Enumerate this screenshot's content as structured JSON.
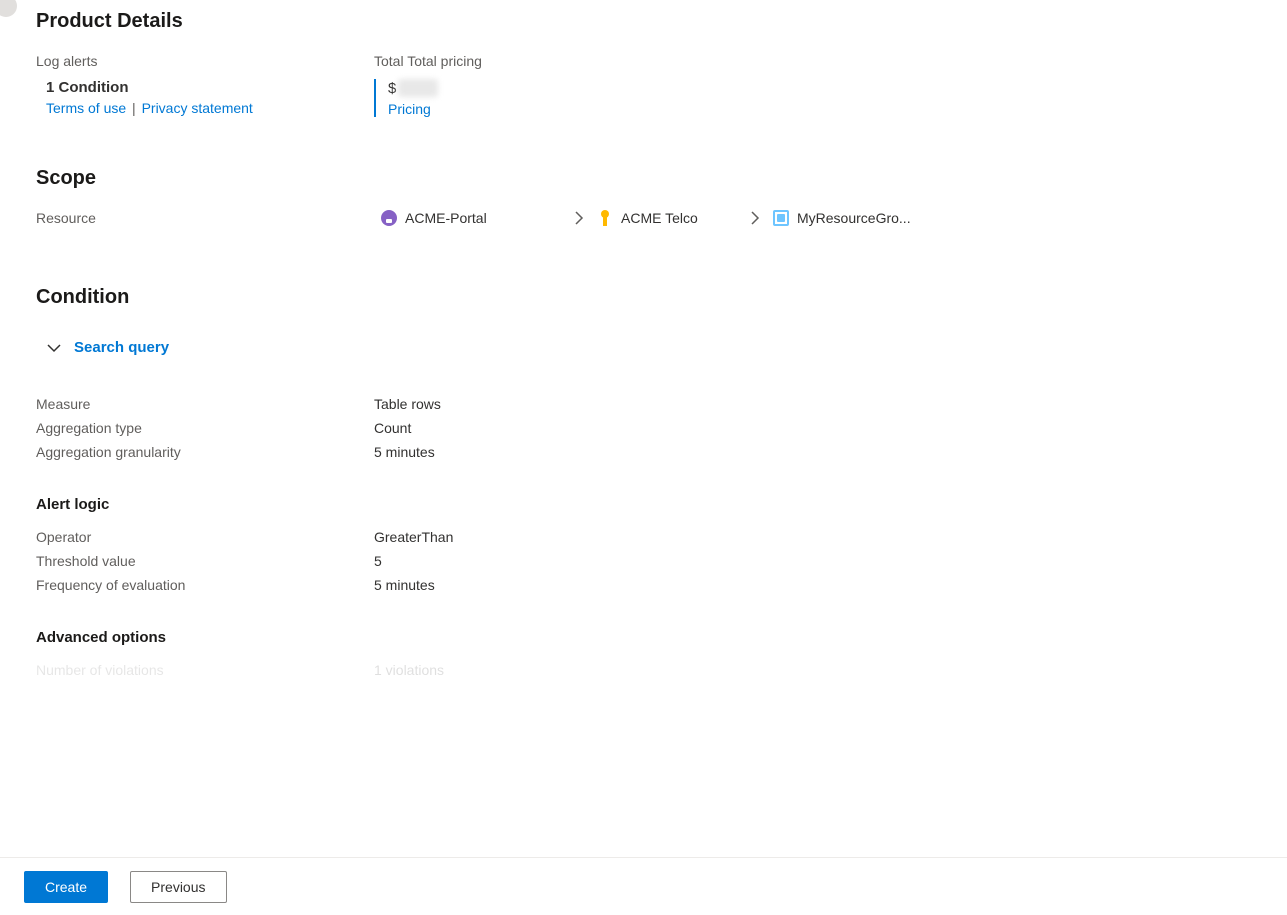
{
  "productDetails": {
    "heading": "Product Details",
    "logAlerts": {
      "label": "Log alerts",
      "condition": "1 Condition",
      "termsLink": "Terms of use",
      "privacyLink": "Privacy statement"
    },
    "pricing": {
      "label": "Total Total pricing",
      "currency": "$",
      "pricingLink": "Pricing"
    }
  },
  "scope": {
    "heading": "Scope",
    "resourceLabel": "Resource",
    "crumbs": [
      "ACME-Portal",
      "ACME Telco",
      "MyResourceGro..."
    ]
  },
  "condition": {
    "heading": "Condition",
    "searchQuery": "Search query",
    "measure": {
      "label": "Measure",
      "value": "Table rows"
    },
    "aggType": {
      "label": "Aggregation type",
      "value": "Count"
    },
    "aggGranularity": {
      "label": "Aggregation granularity",
      "value": "5 minutes"
    },
    "alertLogicHeading": "Alert logic",
    "operator": {
      "label": "Operator",
      "value": "GreaterThan"
    },
    "threshold": {
      "label": "Threshold value",
      "value": "5"
    },
    "frequency": {
      "label": "Frequency of evaluation",
      "value": "5 minutes"
    },
    "advancedHeading": "Advanced options",
    "violations": {
      "label": "Number of violations",
      "value": "1 violations"
    }
  },
  "footer": {
    "create": "Create",
    "previous": "Previous"
  }
}
